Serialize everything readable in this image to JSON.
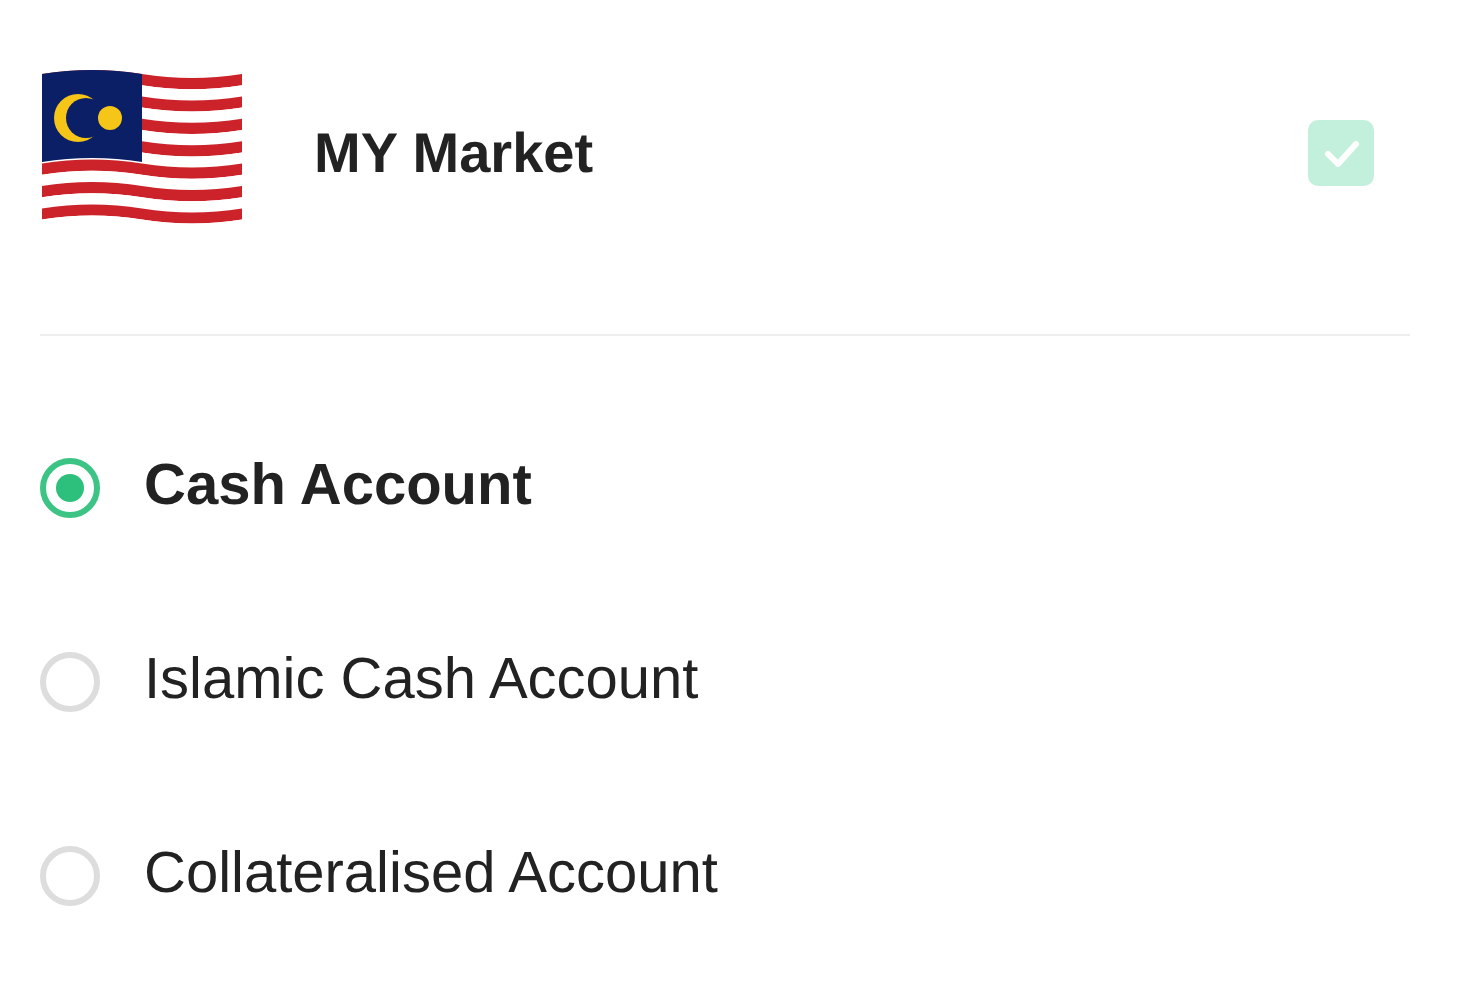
{
  "market": {
    "title": "MY Market",
    "checked": true,
    "disabled": true
  },
  "accounts": [
    {
      "label": "Cash Account",
      "selected": true
    },
    {
      "label": "Islamic Cash Account",
      "selected": false
    },
    {
      "label": "Collateralised Account",
      "selected": false
    }
  ]
}
